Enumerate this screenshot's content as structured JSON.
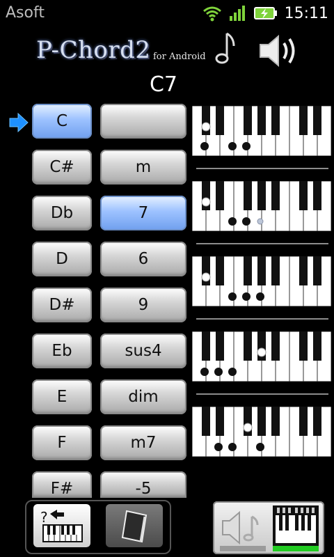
{
  "status_bar": {
    "app_name": "Asoft",
    "time": "15:11",
    "icons": [
      "wifi-icon",
      "signal-icon",
      "battery-charging-icon"
    ]
  },
  "header": {
    "logo_text": "P-Chord2",
    "logo_subtext": "for Android",
    "icons": [
      "music-note-icon",
      "speaker-icon"
    ]
  },
  "chord_name": "C7",
  "selector_arrow_icon": "arrow-right-icon",
  "root_notes": [
    {
      "label": "C",
      "selected": true
    },
    {
      "label": "C#",
      "selected": false
    },
    {
      "label": "Db",
      "selected": false
    },
    {
      "label": "D",
      "selected": false
    },
    {
      "label": "D#",
      "selected": false
    },
    {
      "label": "Eb",
      "selected": false
    },
    {
      "label": "E",
      "selected": false
    },
    {
      "label": "F",
      "selected": false
    },
    {
      "label": "F#",
      "selected": false
    }
  ],
  "chord_qualities": [
    {
      "label": "",
      "selected": false
    },
    {
      "label": "m",
      "selected": false
    },
    {
      "label": "7",
      "selected": true
    },
    {
      "label": "6",
      "selected": false
    },
    {
      "label": "9",
      "selected": false
    },
    {
      "label": "sus4",
      "selected": false
    },
    {
      "label": "dim",
      "selected": false
    },
    {
      "label": "m7",
      "selected": false
    },
    {
      "label": "-5",
      "selected": false
    }
  ],
  "keyboards": [
    {
      "white_dots": [
        0,
        2,
        3
      ],
      "black_dots": [
        1
      ],
      "grey_dots": []
    },
    {
      "white_dots": [
        2,
        3
      ],
      "black_dots": [
        1
      ],
      "grey_dots": [
        4
      ]
    },
    {
      "white_dots": [
        2,
        3,
        4
      ],
      "black_dots": [
        1
      ],
      "grey_dots": []
    },
    {
      "white_dots": [
        0,
        1,
        2
      ],
      "black_dots": [
        4
      ],
      "grey_dots": []
    },
    {
      "white_dots": [
        1,
        2,
        4
      ],
      "black_dots": [
        3
      ],
      "grey_dots": []
    }
  ],
  "bottom_bar": {
    "icons": [
      "help-keyboard-icon",
      "notebook-icon",
      "sound-keyboard-icon"
    ]
  },
  "colors": {
    "selected_button": "#7aa7f2",
    "arrow": "#1e90ff",
    "sound_level": "#22cc22"
  }
}
